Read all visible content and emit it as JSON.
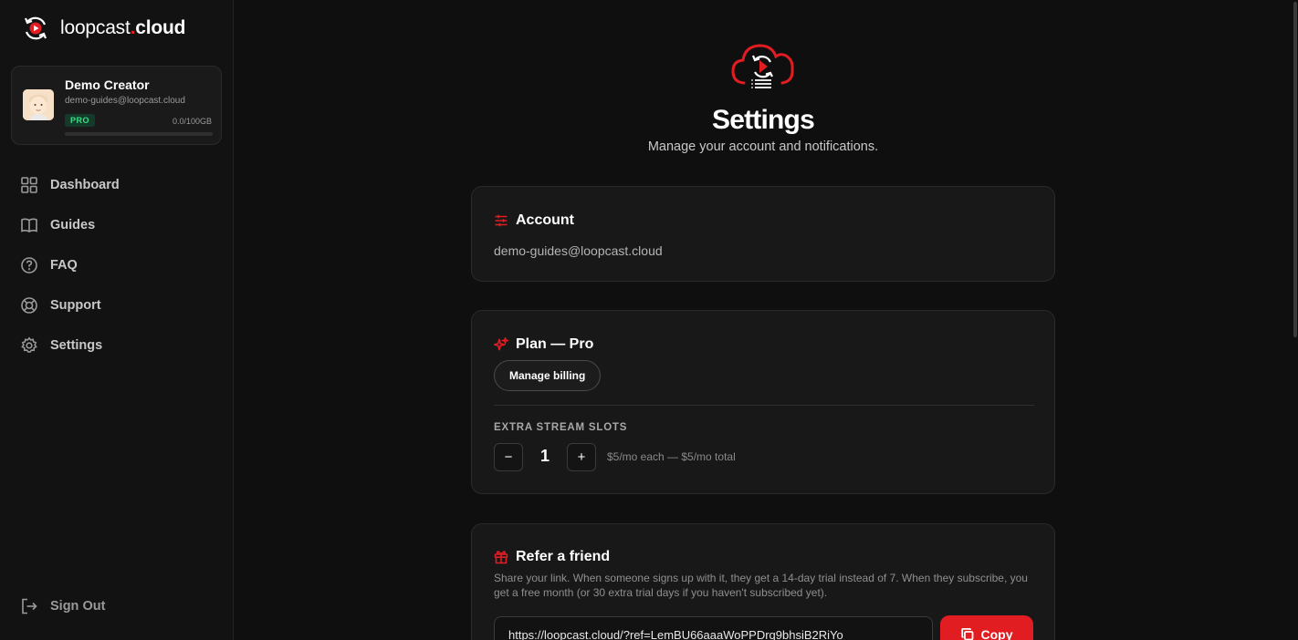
{
  "brand": {
    "name_prefix": "loopcast",
    "name_dot": ".",
    "name_suffix": "cloud",
    "accent_color": "#e11d22"
  },
  "profile": {
    "name": "Demo Creator",
    "email": "demo-guides@loopcast.cloud",
    "badge": "PRO",
    "storage": "0.0/100GB",
    "storage_used_fraction": 0.0
  },
  "nav": {
    "items": [
      {
        "label": "Dashboard",
        "icon": "grid-icon"
      },
      {
        "label": "Guides",
        "icon": "book-icon"
      },
      {
        "label": "FAQ",
        "icon": "help-circle-icon"
      },
      {
        "label": "Support",
        "icon": "lifebuoy-icon"
      },
      {
        "label": "Settings",
        "icon": "gear-icon"
      }
    ],
    "signout_label": "Sign Out"
  },
  "page": {
    "title": "Settings",
    "subtitle": "Manage your account and notifications."
  },
  "account": {
    "title": "Account",
    "email": "demo-guides@loopcast.cloud"
  },
  "plan": {
    "title": "Plan — Pro",
    "manage_billing_label": "Manage billing",
    "slots_label": "EXTRA STREAM SLOTS",
    "minus_label": "−",
    "plus_label": "+",
    "slots_value": "1",
    "slots_price": "$5/mo each — $5/mo total"
  },
  "refer": {
    "title": "Refer a friend",
    "description": "Share your link. When someone signs up with it, they get a 14-day trial instead of 7. When they subscribe, you get a free month (or 30 extra trial days if you haven't subscribed yet).",
    "link": "https://loopcast.cloud/?ref=LemBU66aaaWoPPDrq9bhsiB2RiYo",
    "copy_label": "Copy"
  }
}
